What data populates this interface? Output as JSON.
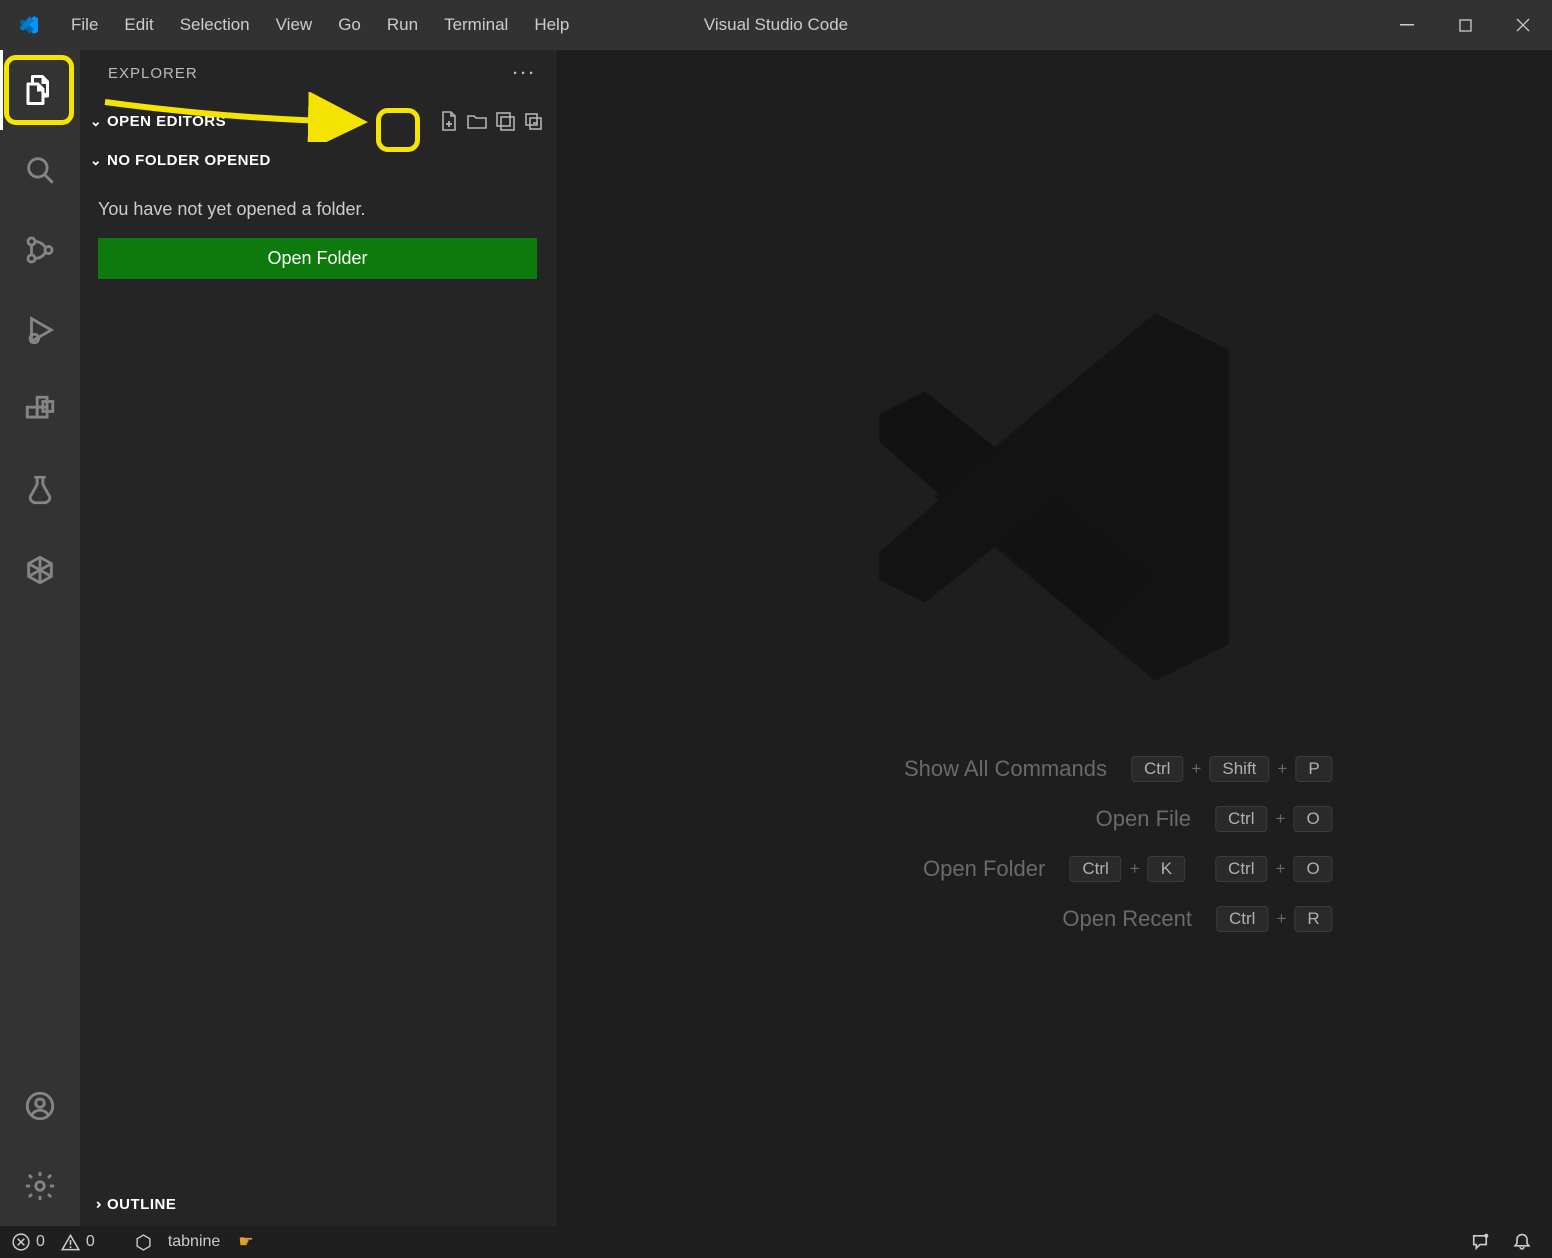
{
  "titleBar": {
    "appTitle": "Visual Studio Code",
    "menu": [
      "File",
      "Edit",
      "Selection",
      "View",
      "Go",
      "Run",
      "Terminal",
      "Help"
    ]
  },
  "sidebar": {
    "title": "EXPLORER",
    "openEditorsLabel": "OPEN EDITORS",
    "noFolderLabel": "NO FOLDER OPENED",
    "noFolderMessage": "You have not yet opened a folder.",
    "openFolderButton": "Open Folder",
    "outlineLabel": "OUTLINE"
  },
  "shortcuts": [
    {
      "label": "Show All Commands",
      "keys": [
        "Ctrl",
        "+",
        "Shift",
        "+",
        "P"
      ]
    },
    {
      "label": "Open File",
      "keys": [
        "Ctrl",
        "+",
        "O"
      ]
    },
    {
      "label": "Open Folder",
      "keys": [
        "Ctrl",
        "+",
        "K",
        "",
        "Ctrl",
        "+",
        "O"
      ]
    },
    {
      "label": "Open Recent",
      "keys": [
        "Ctrl",
        "+",
        "R"
      ]
    }
  ],
  "status": {
    "errors": "0",
    "warnings": "0",
    "extension": "tabnine"
  }
}
